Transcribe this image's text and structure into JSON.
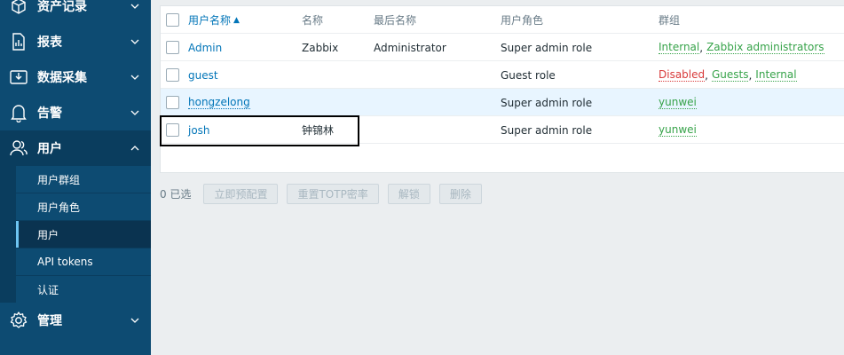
{
  "sidebar": {
    "items": [
      {
        "label": "资产记录",
        "icon": "box-icon"
      },
      {
        "label": "报表",
        "icon": "report-icon"
      },
      {
        "label": "数据采集",
        "icon": "data-collection-icon"
      },
      {
        "label": "告警",
        "icon": "bell-icon"
      },
      {
        "label": "用户",
        "icon": "user-icon"
      },
      {
        "label": "管理",
        "icon": "gear-icon"
      }
    ],
    "submenu": [
      "用户群组",
      "用户角色",
      "用户",
      "API tokens",
      "认证"
    ]
  },
  "table": {
    "headers": {
      "username": "用户名称",
      "name": "名称",
      "surname": "最后名称",
      "role": "用户角色",
      "groups": "群组"
    },
    "sort_arrow": "▲",
    "rows": [
      {
        "username": "Admin",
        "name": "Zabbix",
        "surname": "Administrator",
        "role": "Super admin role",
        "groups": [
          {
            "text": "Internal",
            "status": "green"
          },
          {
            "text": "Zabbix administrators",
            "status": "green"
          }
        ]
      },
      {
        "username": "guest",
        "name": "",
        "surname": "",
        "role": "Guest role",
        "groups": [
          {
            "text": "Disabled",
            "status": "red"
          },
          {
            "text": "Guests",
            "status": "green"
          },
          {
            "text": "Internal",
            "status": "green"
          }
        ]
      },
      {
        "username": "hongzelong",
        "name": "",
        "surname": "",
        "role": "Super admin role",
        "groups": [
          {
            "text": "yunwei",
            "status": "green"
          }
        ]
      },
      {
        "username": "josh",
        "name": "钟锦林",
        "surname": "",
        "role": "Super admin role",
        "groups": [
          {
            "text": "yunwei",
            "status": "green"
          }
        ]
      }
    ]
  },
  "footer": {
    "selected": "0 已选",
    "buttons": [
      "立即预配置",
      "重置TOTP密率",
      "解锁",
      "删除"
    ]
  },
  "colors": {
    "sidebar_bg": "#0d4b72",
    "link": "#0275b8",
    "group_green": "#37a34a",
    "group_red": "#d83a3a"
  }
}
